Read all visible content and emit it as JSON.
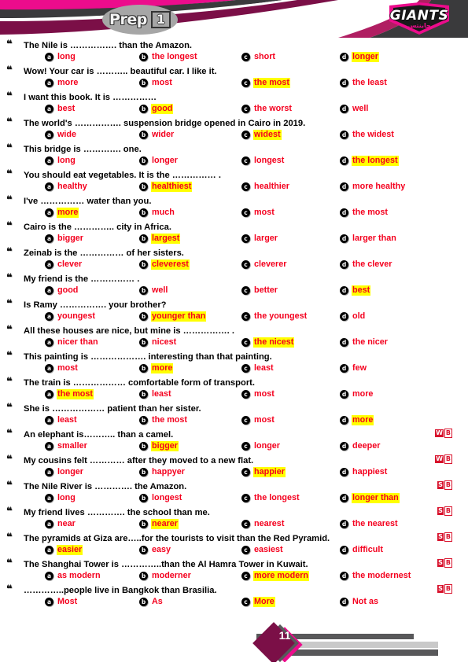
{
  "header": {
    "badge_label": "Prep",
    "badge_number": "1",
    "logo_word": "GIANTS",
    "logo_sub": "جاينتس",
    "colors": {
      "pink": "#EC0C8C",
      "charcoal": "#3A3A3C",
      "maroon": "#7B0F47",
      "badge_gray": "#A6A6A6"
    }
  },
  "styles": {
    "answer_color": "#F4001E",
    "highlight_color": "#FFFF00",
    "badge_red": "#D8122C"
  },
  "option_letters": [
    "a",
    "b",
    "c",
    "d"
  ],
  "questions": [
    {
      "bullet": "❝",
      "text": "The Nile is ……………. than the Amazon.",
      "badge": null,
      "options": [
        "long",
        "the longest",
        "short",
        "longer"
      ],
      "answer": 3
    },
    {
      "bullet": "❝",
      "text": "Wow! Your car is ……….. beautiful car. I like it.",
      "badge": null,
      "options": [
        "more",
        "most",
        "the most",
        "the least"
      ],
      "answer": 2
    },
    {
      "bullet": "❝",
      "text": "I want this book. It is ……………",
      "badge": null,
      "options": [
        "best",
        "good",
        "the worst",
        "well"
      ],
      "answer": 1
    },
    {
      "bullet": "❝",
      "text": "The world's ……………. suspension bridge opened in Cairo in 2019.",
      "badge": null,
      "options": [
        "wide",
        "wider",
        "widest",
        "the widest"
      ],
      "answer": 2
    },
    {
      "bullet": "❝",
      "text": "This bridge is …………. one.",
      "badge": null,
      "options": [
        "long",
        "longer",
        "longest",
        "the longest"
      ],
      "answer": 3
    },
    {
      "bullet": "❝",
      "text": "You should eat vegetables. It is the …………… .",
      "badge": null,
      "options": [
        "healthy",
        "healthiest",
        "healthier",
        "more healthy"
      ],
      "answer": 1
    },
    {
      "bullet": "❝",
      "text": "I've …………… water than you.",
      "badge": null,
      "options": [
        "more",
        "much",
        "most",
        "the most"
      ],
      "answer": 0
    },
    {
      "bullet": "❝",
      "text": "Cairo is the ………….. city in Africa.",
      "badge": null,
      "options": [
        "bigger",
        "largest",
        "larger",
        "larger than"
      ],
      "answer": 1
    },
    {
      "bullet": "❝",
      "text": "Zeinab is the …………… of her sisters.",
      "badge": null,
      "options": [
        "clever",
        "cleverest",
        "cleverer",
        "the clever"
      ],
      "answer": 1
    },
    {
      "bullet": "❝",
      "text": "My friend is the …………… .",
      "badge": null,
      "options": [
        "good",
        "well",
        "better",
        "best"
      ],
      "answer": 3
    },
    {
      "bullet": "❝",
      "text": "Is Ramy ……………. your brother?",
      "badge": null,
      "options": [
        "youngest",
        "younger than",
        "the youngest",
        "old"
      ],
      "answer": 1
    },
    {
      "bullet": "❝",
      "text": "All these houses are nice, but mine is ……………. .",
      "badge": null,
      "options": [
        "nicer than",
        "nicest",
        "the nicest",
        "the nicer"
      ],
      "answer": 2
    },
    {
      "bullet": "❝",
      "text": "This painting is ………………. interesting than that painting.",
      "badge": null,
      "options": [
        "most",
        "more",
        "least",
        "few"
      ],
      "answer": 1
    },
    {
      "bullet": "❝",
      "text": "The train is ……………… comfortable form of transport.",
      "badge": null,
      "options": [
        "the most",
        "least",
        "most",
        "more"
      ],
      "answer": 0
    },
    {
      "bullet": "❝",
      "text": "She is ……………… patient than her sister.",
      "badge": null,
      "options": [
        "least",
        "the most",
        "most",
        "more"
      ],
      "answer": 3
    },
    {
      "bullet": "❝",
      "text": "An elephant is……….. than a camel.",
      "badge": "WB",
      "options": [
        "smaller",
        "bigger",
        "longer",
        "deeper"
      ],
      "answer": 1
    },
    {
      "bullet": "❝",
      "text": "My cousins felt ………… after they moved to a new flat.",
      "badge": "WB",
      "options": [
        "longer",
        "happyer",
        "happier",
        "happiest"
      ],
      "answer": 2
    },
    {
      "bullet": "❝",
      "text": "The Nile River is …………. the Amazon.",
      "badge": "SB",
      "options": [
        "long",
        "longest",
        "the longest",
        "longer than"
      ],
      "answer": 3
    },
    {
      "bullet": "❝",
      "text": "My friend lives …………. the school than me.",
      "badge": "SB",
      "options": [
        "near",
        "nearer",
        "nearest",
        "the nearest"
      ],
      "answer": 1
    },
    {
      "bullet": "❝",
      "text": "The pyramids at Giza are…..for the tourists to visit than the Red Pyramid.",
      "badge": "SB",
      "options": [
        "easier",
        "easy",
        "easiest",
        "difficult"
      ],
      "answer": 0
    },
    {
      "bullet": "❝",
      "text": "The Shanghai Tower is …………..than the Al Hamra Tower in Kuwait.",
      "badge": "SB",
      "options": [
        "as modern",
        "moderner",
        "more modern",
        "the modernest"
      ],
      "answer": 2
    },
    {
      "bullet": "❝",
      "text": "…………..people live in Bangkok than Brasilia.",
      "badge": "SB",
      "options": [
        "Most",
        "As",
        "More",
        "Not as"
      ],
      "answer": 2
    }
  ],
  "footer": {
    "page_number": "11"
  }
}
